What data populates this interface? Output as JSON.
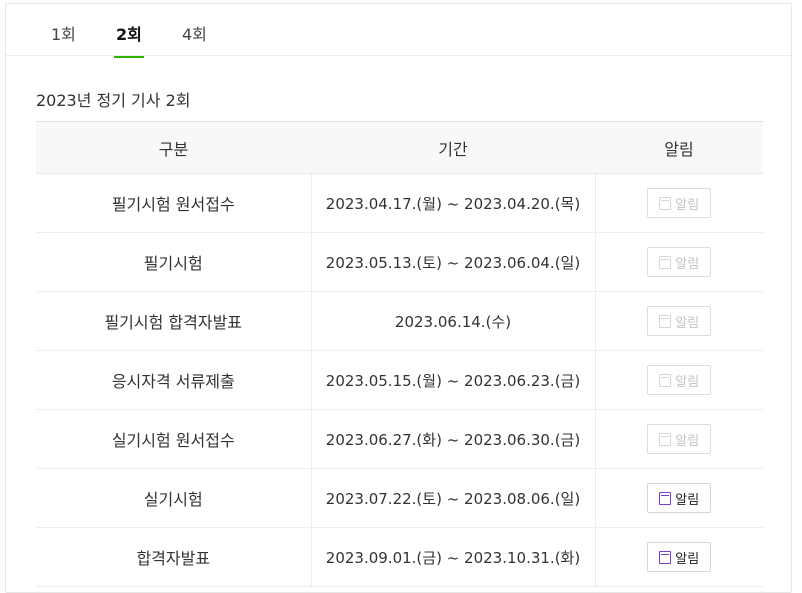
{
  "tabs": [
    {
      "label": "1회",
      "active": false
    },
    {
      "label": "2회",
      "active": true
    },
    {
      "label": "4회",
      "active": false
    }
  ],
  "section_title": "2023년 정기 기사 2회",
  "table": {
    "headers": [
      "구분",
      "기간",
      "알림"
    ],
    "rows": [
      {
        "category": "필기시험 원서접수",
        "period": "2023.04.17.(월) ~ 2023.04.20.(목)",
        "alarm_label": "알림",
        "alarm_enabled": false
      },
      {
        "category": "필기시험",
        "period": "2023.05.13.(토) ~ 2023.06.04.(일)",
        "alarm_label": "알림",
        "alarm_enabled": false
      },
      {
        "category": "필기시험 합격자발표",
        "period": "2023.06.14.(수)",
        "alarm_label": "알림",
        "alarm_enabled": false
      },
      {
        "category": "응시자격 서류제출",
        "period": "2023.05.15.(월) ~ 2023.06.23.(금)",
        "alarm_label": "알림",
        "alarm_enabled": false
      },
      {
        "category": "실기시험 원서접수",
        "period": "2023.06.27.(화) ~ 2023.06.30.(금)",
        "alarm_label": "알림",
        "alarm_enabled": false
      },
      {
        "category": "실기시험",
        "period": "2023.07.22.(토) ~ 2023.08.06.(일)",
        "alarm_label": "알림",
        "alarm_enabled": true
      },
      {
        "category": "합격자발표",
        "period": "2023.09.01.(금) ~ 2023.10.31.(화)",
        "alarm_label": "알림",
        "alarm_enabled": true
      }
    ]
  },
  "colors": {
    "accent": "#2db400",
    "alarm_icon_enabled": "#7a3fc9",
    "alarm_icon_disabled": "#d7d7d7"
  },
  "icons": {
    "alarm": "calendar-icon"
  }
}
